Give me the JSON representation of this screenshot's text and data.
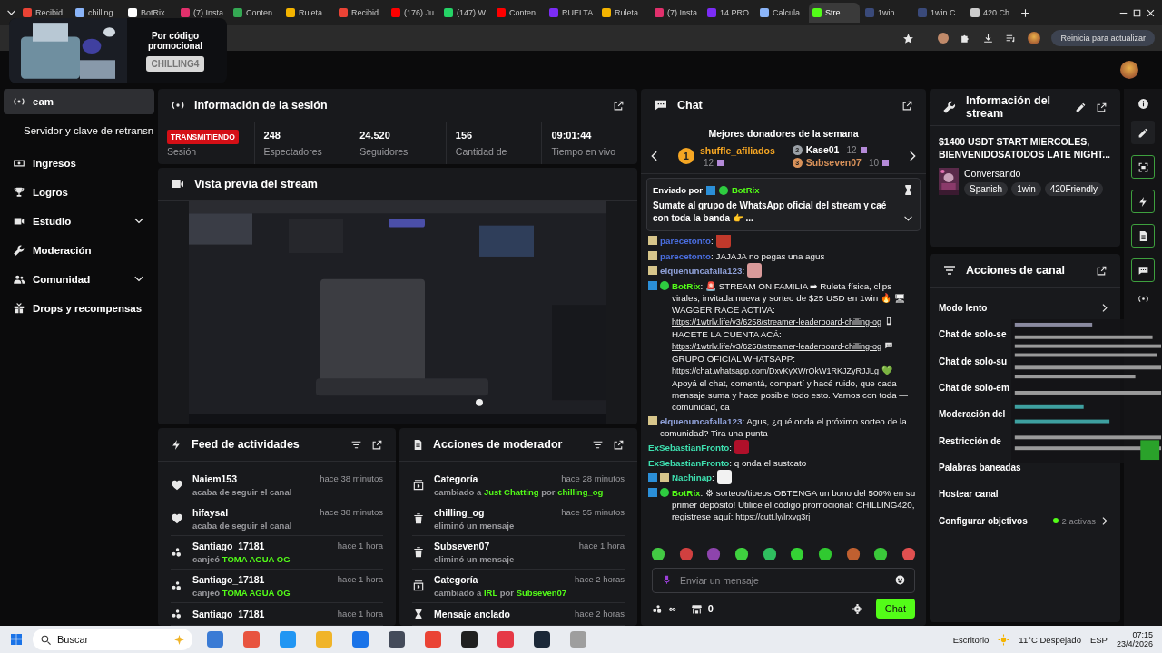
{
  "browser": {
    "tabs": [
      {
        "title": "Recibid",
        "color": "#ea4335",
        "selected": false
      },
      {
        "title": "chilling",
        "color": "#8ab4f8",
        "selected": false
      },
      {
        "title": "BotRix",
        "color": "#ffffff",
        "selected": false
      },
      {
        "title": "(7) Insta",
        "color": "#e1306c",
        "selected": false
      },
      {
        "title": "Conten",
        "color": "#34a853",
        "selected": false
      },
      {
        "title": "Ruleta",
        "color": "#f4b400",
        "selected": false
      },
      {
        "title": "Recibid",
        "color": "#ea4335",
        "selected": false
      },
      {
        "title": "(176) Ju",
        "color": "#ff0000",
        "selected": false
      },
      {
        "title": "(147) W",
        "color": "#25d366",
        "selected": false
      },
      {
        "title": "Conten",
        "color": "#ff0000",
        "selected": false
      },
      {
        "title": "RUELTA",
        "color": "#7b2cf5",
        "selected": false
      },
      {
        "title": "Ruleta",
        "color": "#f4b400",
        "selected": false
      },
      {
        "title": "(7) Insta",
        "color": "#e1306c",
        "selected": false
      },
      {
        "title": "14 PRO",
        "color": "#7b2cf5",
        "selected": false
      },
      {
        "title": "Calcula",
        "color": "#8ab4f8",
        "selected": false
      },
      {
        "title": "Stre",
        "color": "#53fc18",
        "selected": true
      },
      {
        "title": "1win",
        "color": "#3a4a7a",
        "selected": false
      },
      {
        "title": "1win C",
        "color": "#3a4a7a",
        "selected": false
      },
      {
        "title": "420 Ch",
        "color": "#cccccc",
        "selected": false
      }
    ],
    "update_button": "Reinicia para actualizar"
  },
  "ad": {
    "title": "Por código promocional",
    "code": "CHILLING4"
  },
  "sidebar": {
    "items": [
      {
        "label": "eam",
        "kind": "link",
        "selected": true
      },
      {
        "label": "Servidor y clave de retransn",
        "kind": "link",
        "selected": false
      },
      {
        "label": "Ingresos",
        "kind": "link",
        "selected": false
      },
      {
        "label": "Logros",
        "kind": "link",
        "selected": false
      },
      {
        "label": "Estudio",
        "kind": "group",
        "selected": false
      },
      {
        "label": "Moderación",
        "kind": "link",
        "selected": false
      },
      {
        "label": "Comunidad",
        "kind": "group",
        "selected": false
      },
      {
        "label": "Drops y recompensas",
        "kind": "link",
        "selected": false
      }
    ]
  },
  "session": {
    "title": "Información de la sesión",
    "status": "TRANSMITIENDO",
    "status_label": "Sesión",
    "stats": [
      {
        "value": "248",
        "label": "Espectadores"
      },
      {
        "value": "24.520",
        "label": "Seguidores"
      },
      {
        "value": "156",
        "label": "Cantidad de"
      },
      {
        "value": "09:01:44",
        "label": "Tiempo en vivo"
      }
    ]
  },
  "preview": {
    "title": "Vista previa del stream"
  },
  "activity": {
    "title": "Feed de actividades",
    "items": [
      {
        "kind": "follow",
        "user": "Naiem153",
        "time": "hace 38 minutos",
        "parts": [
          {
            "text": "acaba de seguir el canal",
            "kind": "plain"
          }
        ]
      },
      {
        "kind": "follow",
        "user": "hifaysal",
        "time": "hace 38 minutos",
        "parts": [
          {
            "text": "acaba de seguir el canal",
            "kind": "plain"
          }
        ]
      },
      {
        "kind": "redeem",
        "user": "Santiago_17181",
        "time": "hace 1 hora",
        "parts": [
          {
            "text": "canjeó ",
            "kind": "plain"
          },
          {
            "text": "TOMA AGUA OG",
            "kind": "highlight"
          }
        ]
      },
      {
        "kind": "redeem",
        "user": "Santiago_17181",
        "time": "hace 1 hora",
        "parts": [
          {
            "text": "canjeó ",
            "kind": "plain"
          },
          {
            "text": "TOMA AGUA OG",
            "kind": "highlight"
          }
        ]
      },
      {
        "kind": "redeem",
        "user": "Santiago_17181",
        "time": "hace 1 hora"
      }
    ]
  },
  "mod_actions": {
    "title": "Acciones de moderador",
    "items": [
      {
        "kind": "category",
        "user": "Categoría",
        "time": "hace 28 minutos",
        "parts": [
          {
            "text": "cambiado a ",
            "kind": "plain"
          },
          {
            "text": "Just Chatting",
            "kind": "highlight"
          },
          {
            "text": " por ",
            "kind": "plain"
          },
          {
            "text": "chilling_og",
            "kind": "highlight"
          }
        ]
      },
      {
        "kind": "delete",
        "user": "chilling_og",
        "time": "hace 55 minutos",
        "parts": [
          {
            "text": "eliminó un mensaje",
            "kind": "plain"
          }
        ]
      },
      {
        "kind": "delete",
        "user": "Subseven07",
        "time": "hace 1 hora",
        "parts": [
          {
            "text": "eliminó un mensaje",
            "kind": "plain"
          }
        ]
      },
      {
        "kind": "category",
        "user": "Categoría",
        "time": "hace 2 horas",
        "parts": [
          {
            "text": "cambiado a ",
            "kind": "plain"
          },
          {
            "text": "IRL",
            "kind": "highlight"
          },
          {
            "text": " por ",
            "kind": "plain"
          },
          {
            "text": "Subseven07",
            "kind": "highlight"
          }
        ]
      },
      {
        "kind": "pin",
        "user": "Mensaje anclado",
        "time": "hace 2 horas"
      }
    ]
  },
  "chat": {
    "title": "Chat",
    "donors_title": "Mejores donadores de la semana",
    "donors": [
      {
        "rank": "1",
        "name": "shuffle_afiliados",
        "count": "12",
        "color": "#f5a623"
      },
      {
        "rank": "2",
        "name": "Kase01",
        "count": "12",
        "color": "#9aa0a6"
      },
      {
        "rank": "3",
        "name": "Subseven07",
        "count": "10",
        "color": "#d9925a"
      }
    ],
    "pinned": {
      "label": "Enviado por",
      "user": "BotRix",
      "text": "Sumate al grupo de WhatsApp oficial del stream y caé con toda la banda 👉 ..."
    },
    "messages": [
      {
        "kind": "emote",
        "badges": [
          {
            "kind": "sub"
          }
        ],
        "user": "parecetonto",
        "color": "#4a6ee0",
        "parts": [
          {
            "text": ":",
            "kind": "text"
          }
        ]
      },
      {
        "kind": "text",
        "badges": [
          {
            "kind": "sub"
          }
        ],
        "user": "parecetonto",
        "color": "#4a6ee0",
        "parts": [
          {
            "text": ": JAJAJA no pegas una agus",
            "kind": "text"
          }
        ]
      },
      {
        "kind": "emote",
        "badges": [
          {
            "kind": "sub"
          }
        ],
        "user": "elquenuncafalla123",
        "color": "#8fa0d8",
        "parts": [
          {
            "text": ":",
            "kind": "text"
          }
        ]
      },
      {
        "kind": "text",
        "badges": [
          {
            "kind": "mod"
          },
          {
            "kind": "verified"
          }
        ],
        "user": "BotRix",
        "color": "#53fc18",
        "parts": [
          {
            "text": ": 🚨 STREAM ON FAMILIA ➡ Ruleta física, clips virales, invitada nueva y sorteo de $25 USD en 1win 🔥 🖥 WAGGER RACE ACTIVA: ",
            "kind": "text"
          },
          {
            "text": "https://1wtrlv.life/v3/6258/streamer-leaderboard-chilling-og",
            "kind": "link"
          },
          {
            "kind": "phone"
          },
          {
            "text": " HACETE LA CUENTA ACÁ: ",
            "kind": "text"
          },
          {
            "text": "https://1wtrlv.life/v3/6258/streamer-leaderboard-chilling-og",
            "kind": "link"
          },
          {
            "kind": "speech"
          },
          {
            "text": " GRUPO OFICIAL WHATSAPP: ",
            "kind": "text"
          },
          {
            "text": "https://chat.whatsapp.com/DxvKyXWrQkW1RKJZyRJJLg",
            "kind": "link"
          },
          {
            "text": " 💚 Apoyá el chat, comentá, compartí y hacé ruido, que cada mensaje suma y hace posible todo esto. Vamos con toda — comunidad, ca",
            "kind": "text"
          }
        ]
      },
      {
        "kind": "text",
        "badges": [
          {
            "kind": "sub"
          }
        ],
        "user": "elquenuncafalla123",
        "color": "#8fa0d8",
        "parts": [
          {
            "text": ": Agus, ¿qué onda el próximo sorteo de la comunidad? Tira una punta",
            "kind": "text"
          }
        ]
      },
      {
        "kind": "emote",
        "user": "ExSebastianFronto",
        "color": "#3ee0b0",
        "parts": [
          {
            "text": ":",
            "kind": "text"
          }
        ]
      },
      {
        "kind": "text",
        "user": "ExSebastianFronto",
        "color": "#3ee0b0",
        "parts": [
          {
            "text": ": q onda el sustcato",
            "kind": "text"
          }
        ]
      },
      {
        "kind": "emote",
        "badges": [
          {
            "kind": "mod"
          },
          {
            "kind": "sub"
          }
        ],
        "user": "Nachinap",
        "color": "#3ee0b0",
        "parts": [
          {
            "text": ":",
            "kind": "text"
          }
        ]
      },
      {
        "kind": "text",
        "badges": [
          {
            "kind": "mod"
          },
          {
            "kind": "verified"
          }
        ],
        "user": "BotRix",
        "color": "#53fc18",
        "parts": [
          {
            "text": ": ⚙ sorteos/tipeos OBTENGA un bono del 500% en su primer depósito! Utilice el código promocional: CHILLING420, registrese aquí: ",
            "kind": "text"
          },
          {
            "text": "https://cutt.ly/lrxvg3rj",
            "kind": "link"
          }
        ]
      }
    ],
    "placeholder": "Enviar un mensaje",
    "points": "∞",
    "store_count": "0",
    "send_button": "Chat"
  },
  "stream_info": {
    "title": "Información del stream",
    "stream_title": "$1400 USDT START MIERCOLES, BIENVENIDOSATODOS LATE NIGHT...",
    "category": "Conversando",
    "tags": [
      "Spanish",
      "1win",
      "420Friendly"
    ]
  },
  "channel_actions": {
    "title": "Acciones de canal",
    "rows": [
      {
        "label": "Modo lento",
        "kind": "link"
      },
      {
        "label": "Chat de solo-se",
        "kind": "plain"
      },
      {
        "label": "Chat de solo-su",
        "kind": "plain"
      },
      {
        "label": "Chat de solo-em",
        "kind": "plain"
      },
      {
        "label": "Moderación del",
        "kind": "plain"
      },
      {
        "label": "Restricción de",
        "kind": "plain"
      },
      {
        "label": "Palabras baneadas",
        "kind": "plain"
      },
      {
        "label": "Hostear canal",
        "kind": "plain"
      },
      {
        "label": "Configurar objetivos",
        "kind": "status",
        "status": "2 activas"
      }
    ]
  },
  "taskbar": {
    "search": "Buscar",
    "desktop": "Escritorio",
    "weather": "11°C Despejado",
    "language": "ESP",
    "time": "07:15",
    "date": "23/4/2026"
  }
}
